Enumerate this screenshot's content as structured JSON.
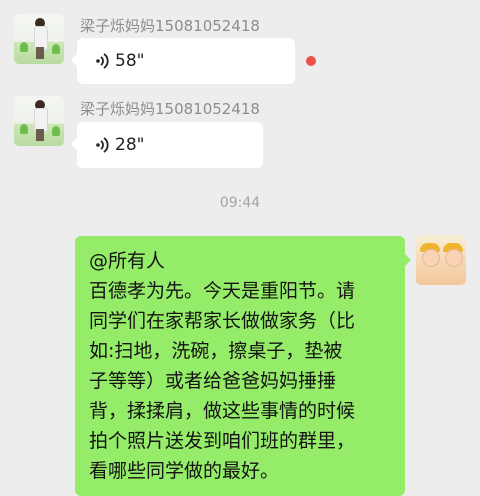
{
  "chat": {
    "messages": [
      {
        "type": "voice",
        "sender": "梁子烁妈妈15081052418",
        "duration": "58\"",
        "unread": true
      },
      {
        "type": "voice",
        "sender": "梁子烁妈妈15081052418",
        "duration": "28\"",
        "unread": false
      }
    ],
    "timestamp": "09:44",
    "self_message": {
      "lines": [
        "@所有人",
        "百德孝为先。今天是重阳节。请",
        "同学们在家帮家长做做家务（比",
        "如:扫地，洗碗，擦桌子，垫被",
        "子等等）或者给爸爸妈妈捶捶",
        "背，揉揉肩，做这些事情的时候",
        "拍个照片送发到咱们班的群里，",
        "看哪些同学做的最好。"
      ]
    }
  },
  "colors": {
    "background": "#ededed",
    "self_bubble": "#95ec69",
    "other_bubble": "#ffffff",
    "unread_dot": "#f0504b"
  },
  "icons": {
    "voice": "voice-wave-icon"
  }
}
